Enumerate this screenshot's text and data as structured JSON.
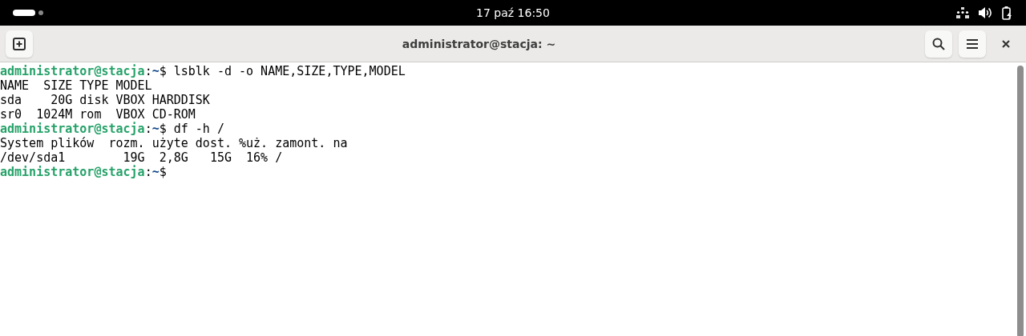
{
  "top_bar": {
    "clock": "17 paź  16:50"
  },
  "window": {
    "title": "administrator@stacja: ~"
  },
  "terminal": {
    "lines": [
      {
        "kind": "prompt",
        "user": "administrator@stacja",
        "colon": ":",
        "path": "~",
        "symbol": "$",
        "command": " lsblk -d -o NAME,SIZE,TYPE,MODEL"
      },
      {
        "kind": "output",
        "text": "NAME  SIZE TYPE MODEL"
      },
      {
        "kind": "output",
        "text": "sda    20G disk VBOX HARDDISK"
      },
      {
        "kind": "output",
        "text": "sr0  1024M rom  VBOX CD-ROM"
      },
      {
        "kind": "prompt",
        "user": "administrator@stacja",
        "colon": ":",
        "path": "~",
        "symbol": "$",
        "command": " df -h /"
      },
      {
        "kind": "output",
        "text": "System plików  rozm. użyte dost. %uż. zamont. na"
      },
      {
        "kind": "output",
        "text": "/dev/sda1        19G  2,8G   15G  16% /"
      },
      {
        "kind": "prompt",
        "user": "administrator@stacja",
        "colon": ":",
        "path": "~",
        "symbol": "$"
      }
    ]
  }
}
